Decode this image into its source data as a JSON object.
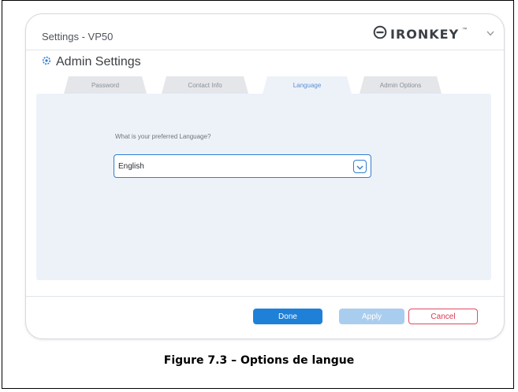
{
  "window": {
    "title": "Settings - VP50",
    "brand": "IRONKEY",
    "brand_mark": "™"
  },
  "admin": {
    "title": "Admin Settings"
  },
  "tabs": [
    {
      "label": "Password",
      "active": false
    },
    {
      "label": "Contact Info",
      "active": false
    },
    {
      "label": "Language",
      "active": true
    },
    {
      "label": "Admin Options",
      "active": false
    }
  ],
  "language": {
    "question": "What is your preferred Language?",
    "selected": "English"
  },
  "buttons": {
    "done": "Done",
    "apply": "Apply",
    "cancel": "Cancel"
  },
  "caption": "Figure 7.3 – Options de langue",
  "icons": {
    "brand_logo": "ironkey-logo-icon",
    "window_menu": "chevron-down-icon",
    "admin": "gear-icon",
    "select_toggle": "chevron-down-icon"
  },
  "colors": {
    "accent": "#1f80d7",
    "apply_disabled": "#a9cdef",
    "cancel": "#e04a5f",
    "panel": "#edf2f9"
  }
}
